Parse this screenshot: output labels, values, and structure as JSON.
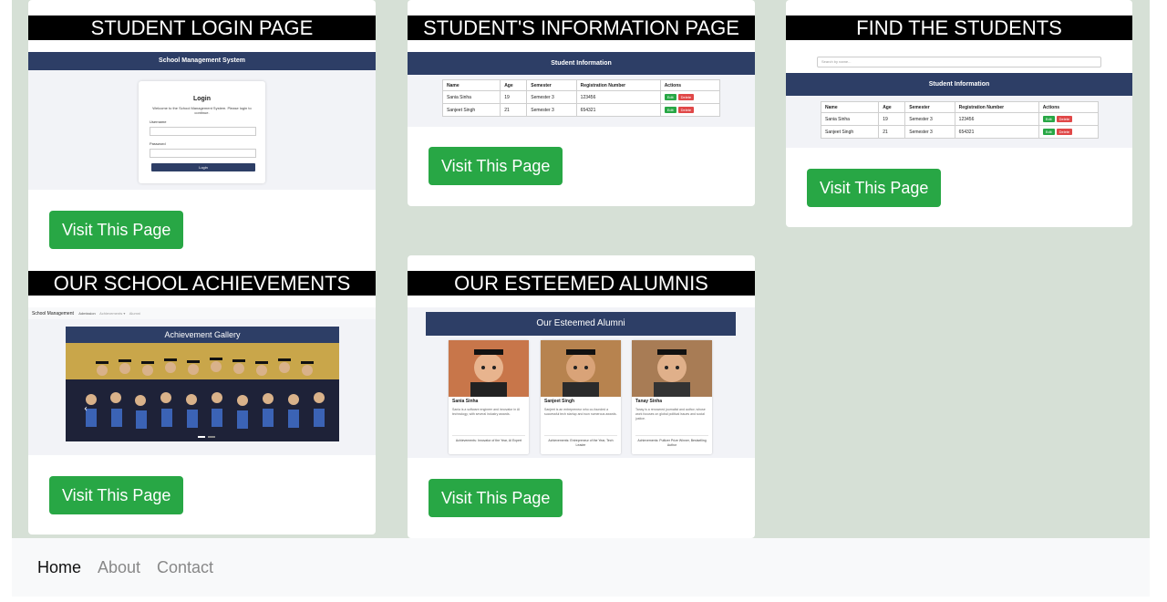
{
  "cards": [
    {
      "title": "STUDENT LOGIN PAGE",
      "button": "Visit This Page",
      "thumb": {
        "header": "School Management System",
        "login_title": "Login",
        "welcome": "Welcome to the School Management System. Please login to continue.",
        "username_label": "Username",
        "password_label": "Password",
        "login_button": "Login"
      }
    },
    {
      "title": "STUDENT'S INFORMATION PAGE",
      "button": "Visit This Page",
      "thumb": {
        "header": "Student Information",
        "columns": [
          "Name",
          "Age",
          "Semester",
          "Registration Number",
          "Actions"
        ],
        "rows": [
          [
            "Sania Sinha",
            "19",
            "Semester 3",
            "123456"
          ],
          [
            "Sanjeet Singh",
            "21",
            "Semester 3",
            "654321"
          ]
        ],
        "edit": "Edit",
        "delete": "Delete"
      }
    },
    {
      "title": "FIND THE STUDENTS",
      "button": "Visit This Page",
      "thumb": {
        "search_placeholder": "Search by name...",
        "header": "Student Information",
        "columns": [
          "Name",
          "Age",
          "Semester",
          "Registration Number",
          "Actions"
        ],
        "rows": [
          [
            "Sania Sinha",
            "19",
            "Semester 3",
            "123456"
          ],
          [
            "Sanjeet Singh",
            "21",
            "Semester 3",
            "654321"
          ]
        ],
        "edit": "Edit",
        "delete": "Delete"
      }
    },
    {
      "title": "OUR SCHOOL ACHIEVEMENTS",
      "button": "Visit This Page",
      "thumb": {
        "nav_brand": "School Management",
        "nav_links": [
          "Admission",
          "Achievements ▾",
          "Alumni"
        ],
        "gallery_title": "Achievement Gallery"
      }
    },
    {
      "title": "OUR ESTEEMED ALUMNIS",
      "button": "Visit This Page",
      "thumb": {
        "header": "Our Esteemed Alumni",
        "alumni": [
          {
            "name": "Sania Sinha",
            "desc": "Sania is a software engineer and innovator in AI technology, with several industry awards.",
            "achievements": "Achievements: Innovator of the Year, AI Expert"
          },
          {
            "name": "Sanjeet Singh",
            "desc": "Sanjeet is an entrepreneur who co-founded a successful tech startup and won numerous awards.",
            "achievements": "Achievements: Entrepreneur of the Year, Tech Leader"
          },
          {
            "name": "Tanay Sinha",
            "desc": "Tanay is a renowned journalist and author, whose work focuses on global political issues and social justice.",
            "achievements": "Achievements: Pulitzer Prize Winner, Bestselling Author"
          }
        ]
      }
    }
  ],
  "footer": {
    "links": [
      "Home",
      "About",
      "Contact"
    ]
  },
  "colors": {
    "accent_button": "#28a745",
    "thumb_header": "#2d3e66",
    "background": "#d6e0d6"
  }
}
